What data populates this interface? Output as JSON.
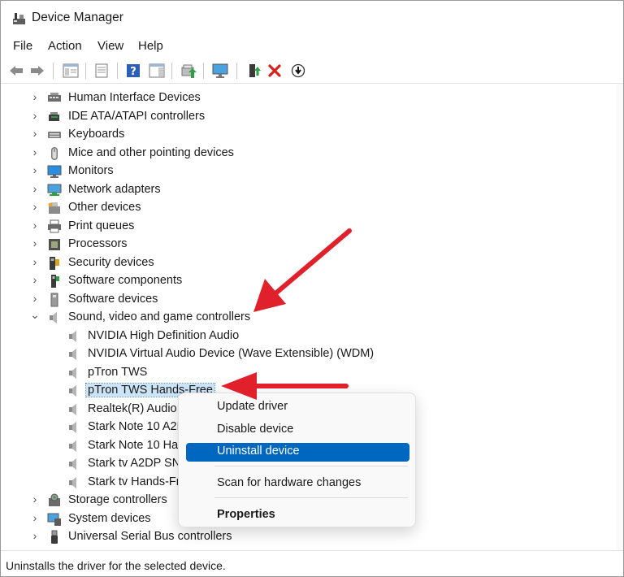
{
  "window": {
    "title": "Device Manager"
  },
  "menubar": {
    "items": [
      "File",
      "Action",
      "View",
      "Help"
    ]
  },
  "toolbar": {
    "buttons": [
      "back-icon",
      "forward-icon",
      "properties-pane-icon",
      "list-view-icon",
      "help-icon",
      "action-pane-icon",
      "update-driver-icon",
      "scan-monitor-icon",
      "enable-device-icon",
      "remove-device-icon",
      "download-circle-icon"
    ]
  },
  "tree": {
    "categories": [
      {
        "label": "Human Interface Devices",
        "icon": "hid-icon",
        "expanded": false
      },
      {
        "label": "IDE ATA/ATAPI controllers",
        "icon": "ide-controller-icon",
        "expanded": false
      },
      {
        "label": "Keyboards",
        "icon": "keyboard-icon",
        "expanded": false
      },
      {
        "label": "Mice and other pointing devices",
        "icon": "mouse-icon",
        "expanded": false
      },
      {
        "label": "Monitors",
        "icon": "monitor-icon",
        "expanded": false
      },
      {
        "label": "Network adapters",
        "icon": "network-adapter-icon",
        "expanded": false
      },
      {
        "label": "Other devices",
        "icon": "other-devices-icon",
        "expanded": false
      },
      {
        "label": "Print queues",
        "icon": "printer-icon",
        "expanded": false
      },
      {
        "label": "Processors",
        "icon": "processor-icon",
        "expanded": false
      },
      {
        "label": "Security devices",
        "icon": "security-key-icon",
        "expanded": false
      },
      {
        "label": "Software components",
        "icon": "software-component-icon",
        "expanded": false
      },
      {
        "label": "Software devices",
        "icon": "software-device-icon",
        "expanded": false
      },
      {
        "label": "Sound, video and game controllers",
        "icon": "speaker-icon",
        "expanded": true
      },
      {
        "label": "Storage controllers",
        "icon": "storage-controller-icon",
        "expanded": false
      },
      {
        "label": "System devices",
        "icon": "system-devices-icon",
        "expanded": false
      },
      {
        "label": "Universal Serial Bus controllers",
        "icon": "usb-icon",
        "expanded": false
      }
    ],
    "sound_children": [
      {
        "label": "NVIDIA High Definition Audio",
        "selected": false
      },
      {
        "label": "NVIDIA Virtual Audio Device (Wave Extensible) (WDM)",
        "selected": false
      },
      {
        "label": "pTron TWS",
        "selected": false
      },
      {
        "label": "pTron TWS Hands-Free",
        "selected": true
      },
      {
        "label": "Realtek(R) Audio",
        "selected": false
      },
      {
        "label": "Stark Note 10 A2D",
        "selected": false
      },
      {
        "label": "Stark Note 10 Har",
        "selected": false
      },
      {
        "label": "Stark tv A2DP SNK",
        "selected": false
      },
      {
        "label": "Stark tv Hands-Fre",
        "selected": false
      }
    ]
  },
  "context_menu": {
    "items": [
      {
        "label": "Update driver",
        "active": false,
        "bold": false
      },
      {
        "label": "Disable device",
        "active": false,
        "bold": false
      },
      {
        "label": "Uninstall device",
        "active": true,
        "bold": false
      },
      {
        "label": "Scan for hardware changes",
        "active": false,
        "bold": false
      },
      {
        "label": "Properties",
        "active": false,
        "bold": true
      }
    ]
  },
  "statusbar": {
    "text": "Uninstalls the driver for the selected device."
  },
  "colors": {
    "accent": "#0067c0",
    "selection": "#cce4f7",
    "annotation_arrow": "#e0202a"
  }
}
